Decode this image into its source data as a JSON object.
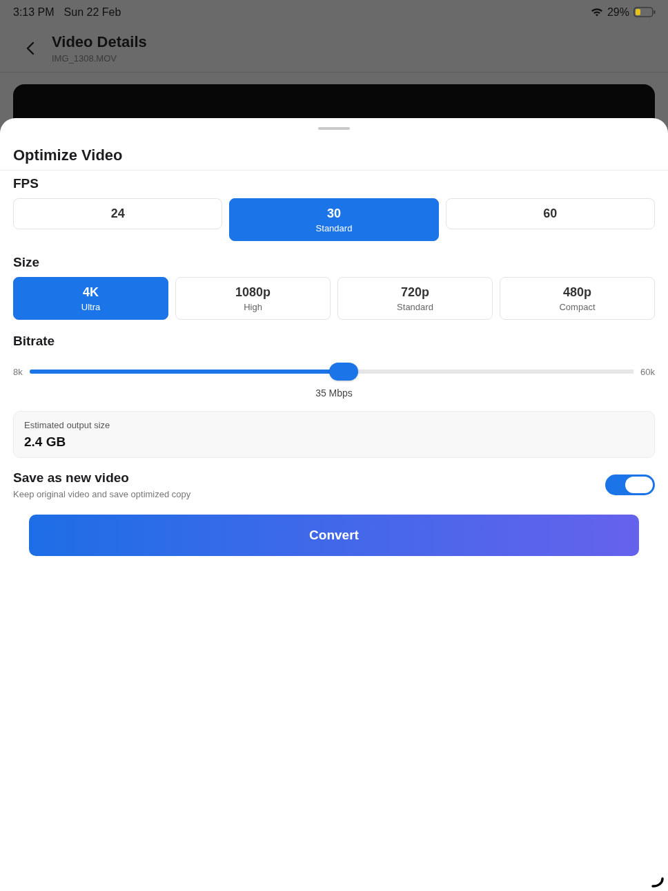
{
  "status_bar": {
    "time": "3:13 PM",
    "date": "Sun 22 Feb",
    "battery": "29%"
  },
  "header": {
    "title": "Video Details",
    "subtitle": "IMG_1308.MOV"
  },
  "sheet": {
    "title": "Optimize Video",
    "fps": {
      "label": "FPS",
      "options": [
        {
          "label": "24",
          "selected": false
        },
        {
          "label": "30",
          "sublabel": "Standard",
          "selected": true
        },
        {
          "label": "60",
          "selected": false
        }
      ]
    },
    "size": {
      "label": "Size",
      "options": [
        {
          "label": "4K",
          "sublabel": "Ultra",
          "selected": true
        },
        {
          "label": "1080p",
          "sublabel": "High",
          "selected": false
        },
        {
          "label": "720p",
          "sublabel": "Standard",
          "selected": false
        },
        {
          "label": "480p",
          "sublabel": "Compact",
          "selected": false
        }
      ]
    },
    "bitrate": {
      "label": "Bitrate",
      "min": "8k",
      "max": "60k",
      "level": 0.52,
      "reading": "35 Mbps"
    },
    "estimate": {
      "label": "Estimated output size",
      "value": "2.4 GB"
    },
    "save_as_new": {
      "title": "Save as new video",
      "description": "Keep original video and save optimized copy",
      "on": true
    },
    "convert_button": "Convert"
  }
}
